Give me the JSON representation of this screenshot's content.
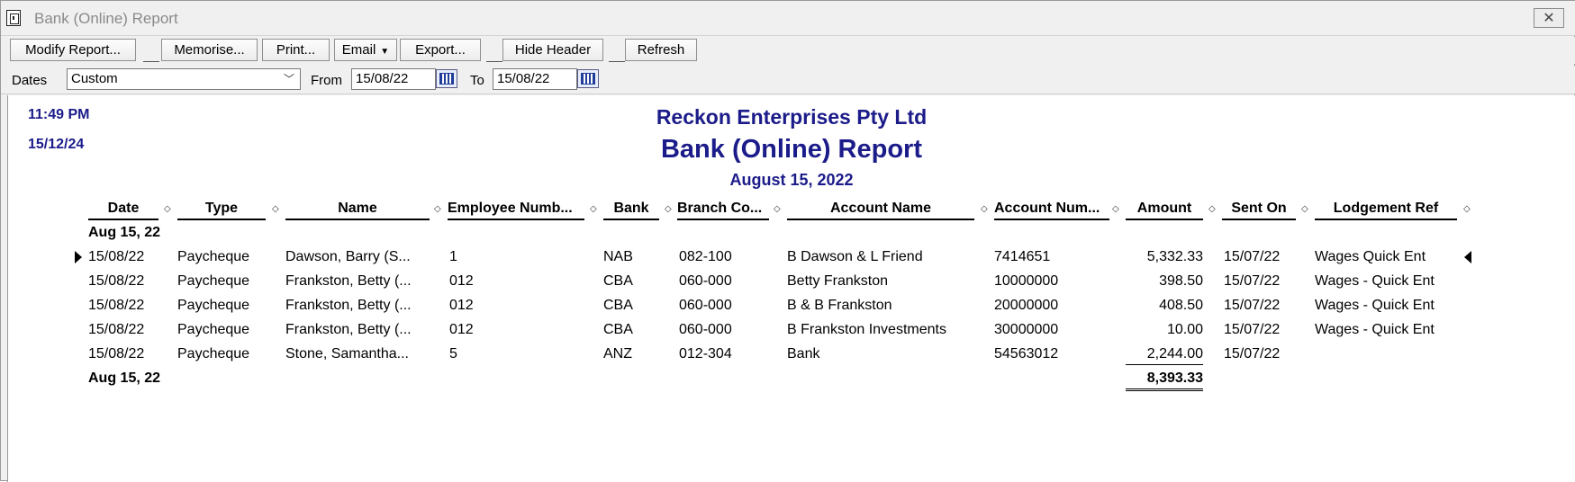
{
  "window": {
    "title": "Bank (Online) Report",
    "close_glyph": "✕"
  },
  "toolbar": {
    "modify_report": "Modify Report...",
    "memorise": "Memorise...",
    "print": "Print...",
    "email": "Email",
    "export": "Export...",
    "hide_header": "Hide Header",
    "refresh": "Refresh"
  },
  "filters": {
    "dates_label": "Dates",
    "dates_value": "Custom",
    "from_label": "From",
    "from_value": "15/08/22",
    "to_label": "To",
    "to_value": "15/08/22"
  },
  "report": {
    "time": "11:49 PM",
    "date": "15/12/24",
    "company": "Reckon Enterprises Pty Ltd",
    "title": "Bank (Online) Report",
    "period": "August 15, 2022",
    "columns": {
      "date": "Date",
      "type": "Type",
      "name": "Name",
      "employee_number": "Employee Numb...",
      "bank": "Bank",
      "branch_code": "Branch Co...",
      "account_name": "Account Name",
      "account_number": "Account Num...",
      "amount": "Amount",
      "sent_on": "Sent On",
      "lodgement_ref": "Lodgement Ref"
    },
    "group_label": "Aug 15, 22",
    "rows": [
      {
        "date": "15/08/22",
        "type": "Paycheque",
        "name": "Dawson, Barry (S...",
        "employee_number": "1",
        "bank": "NAB",
        "branch_code": "082-100",
        "account_name": "B Dawson & L Friend",
        "account_number": "7414651",
        "amount": "5,332.33",
        "sent_on": "15/07/22",
        "lodgement_ref": "Wages Quick Ent"
      },
      {
        "date": "15/08/22",
        "type": "Paycheque",
        "name": "Frankston, Betty (...",
        "employee_number": "012",
        "bank": "CBA",
        "branch_code": "060-000",
        "account_name": "Betty Frankston",
        "account_number": "10000000",
        "amount": "398.50",
        "sent_on": "15/07/22",
        "lodgement_ref": "Wages - Quick Ent"
      },
      {
        "date": "15/08/22",
        "type": "Paycheque",
        "name": "Frankston, Betty (...",
        "employee_number": "012",
        "bank": "CBA",
        "branch_code": "060-000",
        "account_name": "B & B Frankston",
        "account_number": "20000000",
        "amount": "408.50",
        "sent_on": "15/07/22",
        "lodgement_ref": "Wages - Quick Ent"
      },
      {
        "date": "15/08/22",
        "type": "Paycheque",
        "name": "Frankston, Betty (...",
        "employee_number": "012",
        "bank": "CBA",
        "branch_code": "060-000",
        "account_name": "B Frankston Investments",
        "account_number": "30000000",
        "amount": "10.00",
        "sent_on": "15/07/22",
        "lodgement_ref": "Wages - Quick Ent"
      },
      {
        "date": "15/08/22",
        "type": "Paycheque",
        "name": "Stone, Samantha...",
        "employee_number": "5",
        "bank": "ANZ",
        "branch_code": "012-304",
        "account_name": "Bank",
        "account_number": "54563012",
        "amount": "2,244.00",
        "sent_on": "15/07/22",
        "lodgement_ref": ""
      }
    ],
    "total_label": "Aug 15, 22",
    "total_amount": "8,393.33"
  },
  "colors": {
    "header_blue": "#1b1b8a",
    "window_bg": "#f0f0f0"
  },
  "icons": [
    "app-report-icon",
    "close-icon",
    "calendar-icon",
    "chevron-down-icon",
    "row-pointer-icon"
  ]
}
